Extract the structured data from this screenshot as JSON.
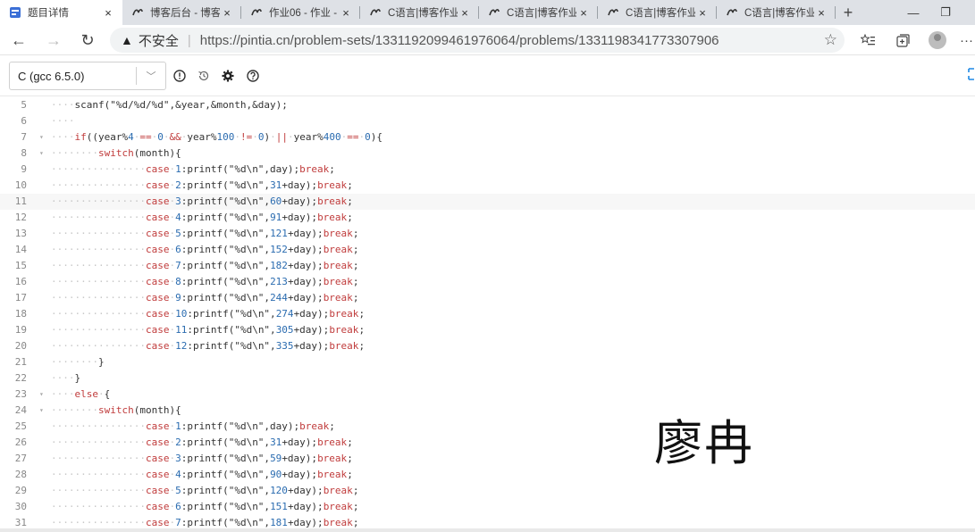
{
  "tabs": [
    {
      "title": "题目详情",
      "active": true
    },
    {
      "title": "博客后台 - 博客",
      "active": false
    },
    {
      "title": "作业06 - 作业 -",
      "active": false
    },
    {
      "title": "C语言|博客作业",
      "active": false
    },
    {
      "title": "C语言|博客作业",
      "active": false
    },
    {
      "title": "C语言|博客作业",
      "active": false
    },
    {
      "title": "C语言|博客作业",
      "active": false
    }
  ],
  "tab_close": "×",
  "new_tab": "+",
  "window": {
    "minimize": "—",
    "restore": "❐"
  },
  "toolbar": {
    "back": "←",
    "forward": "→",
    "reload": "↻",
    "security_icon": "▲",
    "security_label": "不安全",
    "separator": "|",
    "url": "https://pintia.cn/problem-sets/1331192099461976064/problems/1331198341773307906",
    "more": "···"
  },
  "editor": {
    "language": "C (gcc 6.5.0)",
    "chevron": "﹀"
  },
  "code_lines": [
    {
      "n": "5",
      "fold": "",
      "segs": [
        [
          "d",
          "····"
        ],
        [
          "t",
          "scanf(\"%d/%d/%d\",&year,&month,&day);"
        ]
      ]
    },
    {
      "n": "6",
      "fold": "",
      "segs": [
        [
          "d",
          "····"
        ]
      ]
    },
    {
      "n": "7",
      "fold": "▾",
      "segs": [
        [
          "d",
          "····"
        ],
        [
          "k",
          "if"
        ],
        [
          "t",
          "(("
        ],
        [
          "t",
          "year%"
        ],
        [
          "n",
          "4"
        ],
        [
          "d",
          "·"
        ],
        [
          "k",
          "=="
        ],
        [
          "d",
          "·"
        ],
        [
          "n",
          "0"
        ],
        [
          "d",
          "·"
        ],
        [
          "k",
          "&&"
        ],
        [
          "d",
          "·"
        ],
        [
          "t",
          "year%"
        ],
        [
          "n",
          "100"
        ],
        [
          "d",
          "·"
        ],
        [
          "k",
          "!="
        ],
        [
          "d",
          "·"
        ],
        [
          "n",
          "0"
        ],
        [
          "t",
          ")"
        ],
        [
          "d",
          "·"
        ],
        [
          "k",
          "||"
        ],
        [
          "d",
          "·"
        ],
        [
          "t",
          "year%"
        ],
        [
          "n",
          "400"
        ],
        [
          "d",
          "·"
        ],
        [
          "k",
          "=="
        ],
        [
          "d",
          "·"
        ],
        [
          "n",
          "0"
        ],
        [
          "t",
          "){"
        ]
      ]
    },
    {
      "n": "8",
      "fold": "▾",
      "segs": [
        [
          "d",
          "········"
        ],
        [
          "k",
          "switch"
        ],
        [
          "t",
          "(month){"
        ]
      ]
    },
    {
      "n": "9",
      "fold": "",
      "segs": [
        [
          "d",
          "················"
        ],
        [
          "k",
          "case"
        ],
        [
          "d",
          "·"
        ],
        [
          "n",
          "1"
        ],
        [
          "t",
          ":printf(\"%d\\n\",day);"
        ],
        [
          "k",
          "break"
        ],
        [
          "t",
          ";"
        ]
      ]
    },
    {
      "n": "10",
      "fold": "",
      "segs": [
        [
          "d",
          "················"
        ],
        [
          "k",
          "case"
        ],
        [
          "d",
          "·"
        ],
        [
          "n",
          "2"
        ],
        [
          "t",
          ":printf(\"%d\\n\","
        ],
        [
          "n",
          "31"
        ],
        [
          "t",
          "+day);"
        ],
        [
          "k",
          "break"
        ],
        [
          "t",
          ";"
        ]
      ]
    },
    {
      "n": "11",
      "fold": "",
      "hl": true,
      "segs": [
        [
          "d",
          "················"
        ],
        [
          "k",
          "case"
        ],
        [
          "d",
          "·"
        ],
        [
          "n",
          "3"
        ],
        [
          "t",
          ":printf(\"%d\\n\","
        ],
        [
          "n",
          "60"
        ],
        [
          "t",
          "+day);"
        ],
        [
          "k",
          "break"
        ],
        [
          "t",
          ";"
        ]
      ]
    },
    {
      "n": "12",
      "fold": "",
      "segs": [
        [
          "d",
          "················"
        ],
        [
          "k",
          "case"
        ],
        [
          "d",
          "·"
        ],
        [
          "n",
          "4"
        ],
        [
          "t",
          ":printf(\"%d\\n\","
        ],
        [
          "n",
          "91"
        ],
        [
          "t",
          "+day);"
        ],
        [
          "k",
          "break"
        ],
        [
          "t",
          ";"
        ]
      ]
    },
    {
      "n": "13",
      "fold": "",
      "segs": [
        [
          "d",
          "················"
        ],
        [
          "k",
          "case"
        ],
        [
          "d",
          "·"
        ],
        [
          "n",
          "5"
        ],
        [
          "t",
          ":printf(\"%d\\n\","
        ],
        [
          "n",
          "121"
        ],
        [
          "t",
          "+day);"
        ],
        [
          "k",
          "break"
        ],
        [
          "t",
          ";"
        ]
      ]
    },
    {
      "n": "14",
      "fold": "",
      "segs": [
        [
          "d",
          "················"
        ],
        [
          "k",
          "case"
        ],
        [
          "d",
          "·"
        ],
        [
          "n",
          "6"
        ],
        [
          "t",
          ":printf(\"%d\\n\","
        ],
        [
          "n",
          "152"
        ],
        [
          "t",
          "+day);"
        ],
        [
          "k",
          "break"
        ],
        [
          "t",
          ";"
        ]
      ]
    },
    {
      "n": "15",
      "fold": "",
      "segs": [
        [
          "d",
          "················"
        ],
        [
          "k",
          "case"
        ],
        [
          "d",
          "·"
        ],
        [
          "n",
          "7"
        ],
        [
          "t",
          ":printf(\"%d\\n\","
        ],
        [
          "n",
          "182"
        ],
        [
          "t",
          "+day);"
        ],
        [
          "k",
          "break"
        ],
        [
          "t",
          ";"
        ]
      ]
    },
    {
      "n": "16",
      "fold": "",
      "segs": [
        [
          "d",
          "················"
        ],
        [
          "k",
          "case"
        ],
        [
          "d",
          "·"
        ],
        [
          "n",
          "8"
        ],
        [
          "t",
          ":printf(\"%d\\n\","
        ],
        [
          "n",
          "213"
        ],
        [
          "t",
          "+day);"
        ],
        [
          "k",
          "break"
        ],
        [
          "t",
          ";"
        ]
      ]
    },
    {
      "n": "17",
      "fold": "",
      "segs": [
        [
          "d",
          "················"
        ],
        [
          "k",
          "case"
        ],
        [
          "d",
          "·"
        ],
        [
          "n",
          "9"
        ],
        [
          "t",
          ":printf(\"%d\\n\","
        ],
        [
          "n",
          "244"
        ],
        [
          "t",
          "+day);"
        ],
        [
          "k",
          "break"
        ],
        [
          "t",
          ";"
        ]
      ]
    },
    {
      "n": "18",
      "fold": "",
      "segs": [
        [
          "d",
          "················"
        ],
        [
          "k",
          "case"
        ],
        [
          "d",
          "·"
        ],
        [
          "n",
          "10"
        ],
        [
          "t",
          ":printf(\"%d\\n\","
        ],
        [
          "n",
          "274"
        ],
        [
          "t",
          "+day);"
        ],
        [
          "k",
          "break"
        ],
        [
          "t",
          ";"
        ]
      ]
    },
    {
      "n": "19",
      "fold": "",
      "segs": [
        [
          "d",
          "················"
        ],
        [
          "k",
          "case"
        ],
        [
          "d",
          "·"
        ],
        [
          "n",
          "11"
        ],
        [
          "t",
          ":printf(\"%d\\n\","
        ],
        [
          "n",
          "305"
        ],
        [
          "t",
          "+day);"
        ],
        [
          "k",
          "break"
        ],
        [
          "t",
          ";"
        ]
      ]
    },
    {
      "n": "20",
      "fold": "",
      "segs": [
        [
          "d",
          "················"
        ],
        [
          "k",
          "case"
        ],
        [
          "d",
          "·"
        ],
        [
          "n",
          "12"
        ],
        [
          "t",
          ":printf(\"%d\\n\","
        ],
        [
          "n",
          "335"
        ],
        [
          "t",
          "+day);"
        ],
        [
          "k",
          "break"
        ],
        [
          "t",
          ";"
        ]
      ]
    },
    {
      "n": "21",
      "fold": "",
      "segs": [
        [
          "d",
          "········"
        ],
        [
          "t",
          "}"
        ]
      ]
    },
    {
      "n": "22",
      "fold": "",
      "segs": [
        [
          "d",
          "····"
        ],
        [
          "t",
          "}"
        ]
      ]
    },
    {
      "n": "23",
      "fold": "▾",
      "segs": [
        [
          "d",
          "····"
        ],
        [
          "k",
          "else"
        ],
        [
          "d",
          "·"
        ],
        [
          "t",
          "{"
        ]
      ]
    },
    {
      "n": "24",
      "fold": "▾",
      "segs": [
        [
          "d",
          "········"
        ],
        [
          "k",
          "switch"
        ],
        [
          "t",
          "(month){"
        ]
      ]
    },
    {
      "n": "25",
      "fold": "",
      "segs": [
        [
          "d",
          "················"
        ],
        [
          "k",
          "case"
        ],
        [
          "d",
          "·"
        ],
        [
          "n",
          "1"
        ],
        [
          "t",
          ":printf(\"%d\\n\",day);"
        ],
        [
          "k",
          "break"
        ],
        [
          "t",
          ";"
        ]
      ]
    },
    {
      "n": "26",
      "fold": "",
      "segs": [
        [
          "d",
          "················"
        ],
        [
          "k",
          "case"
        ],
        [
          "d",
          "·"
        ],
        [
          "n",
          "2"
        ],
        [
          "t",
          ":printf(\"%d\\n\","
        ],
        [
          "n",
          "31"
        ],
        [
          "t",
          "+day);"
        ],
        [
          "k",
          "break"
        ],
        [
          "t",
          ";"
        ]
      ]
    },
    {
      "n": "27",
      "fold": "",
      "segs": [
        [
          "d",
          "················"
        ],
        [
          "k",
          "case"
        ],
        [
          "d",
          "·"
        ],
        [
          "n",
          "3"
        ],
        [
          "t",
          ":printf(\"%d\\n\","
        ],
        [
          "n",
          "59"
        ],
        [
          "t",
          "+day);"
        ],
        [
          "k",
          "break"
        ],
        [
          "t",
          ";"
        ]
      ]
    },
    {
      "n": "28",
      "fold": "",
      "segs": [
        [
          "d",
          "················"
        ],
        [
          "k",
          "case"
        ],
        [
          "d",
          "·"
        ],
        [
          "n",
          "4"
        ],
        [
          "t",
          ":printf(\"%d\\n\","
        ],
        [
          "n",
          "90"
        ],
        [
          "t",
          "+day);"
        ],
        [
          "k",
          "break"
        ],
        [
          "t",
          ";"
        ]
      ]
    },
    {
      "n": "29",
      "fold": "",
      "segs": [
        [
          "d",
          "················"
        ],
        [
          "k",
          "case"
        ],
        [
          "d",
          "·"
        ],
        [
          "n",
          "5"
        ],
        [
          "t",
          ":printf(\"%d\\n\","
        ],
        [
          "n",
          "120"
        ],
        [
          "t",
          "+day);"
        ],
        [
          "k",
          "break"
        ],
        [
          "t",
          ";"
        ]
      ]
    },
    {
      "n": "30",
      "fold": "",
      "segs": [
        [
          "d",
          "················"
        ],
        [
          "k",
          "case"
        ],
        [
          "d",
          "·"
        ],
        [
          "n",
          "6"
        ],
        [
          "t",
          ":printf(\"%d\\n\","
        ],
        [
          "n",
          "151"
        ],
        [
          "t",
          "+day);"
        ],
        [
          "k",
          "break"
        ],
        [
          "t",
          ";"
        ]
      ]
    },
    {
      "n": "31",
      "fold": "",
      "segs": [
        [
          "d",
          "················"
        ],
        [
          "k",
          "case"
        ],
        [
          "d",
          "·"
        ],
        [
          "n",
          "7"
        ],
        [
          "t",
          ":printf(\"%d\\n\","
        ],
        [
          "n",
          "181"
        ],
        [
          "t",
          "+day);"
        ],
        [
          "k",
          "break"
        ],
        [
          "t",
          ";"
        ]
      ]
    }
  ],
  "signature": "廖冉",
  "colors": {
    "keyword": "#c03c3c",
    "number": "#2b6cb0",
    "link_accent": "#1e88e5"
  }
}
